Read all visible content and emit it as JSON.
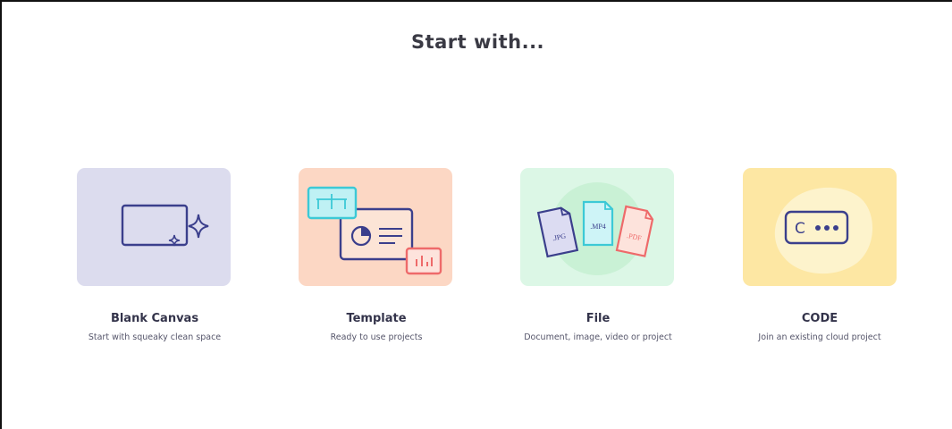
{
  "header": {
    "title": "Start with..."
  },
  "options": [
    {
      "label": "Blank Canvas",
      "description": "Start with squeaky clean space",
      "icon": "canvas-sparkle-icon",
      "bg": "#dcdcee"
    },
    {
      "label": "Template",
      "description": "Ready to use projects",
      "icon": "template-icon",
      "bg": "#fcd7c4"
    },
    {
      "label": "File",
      "description": "Document, image, video or project",
      "icon": "files-icon",
      "bg": "#dcf7e6",
      "file_tags": [
        ".JPG",
        ".MP4",
        ".PDF"
      ]
    },
    {
      "label": "CODE",
      "description": "Join an existing cloud project",
      "icon": "code-icon",
      "bg": "#fde7a3",
      "code_text": "C"
    }
  ],
  "colors": {
    "accent": "#3b3f8c",
    "teal": "#3cc9d6",
    "red": "#ee6a6a"
  }
}
